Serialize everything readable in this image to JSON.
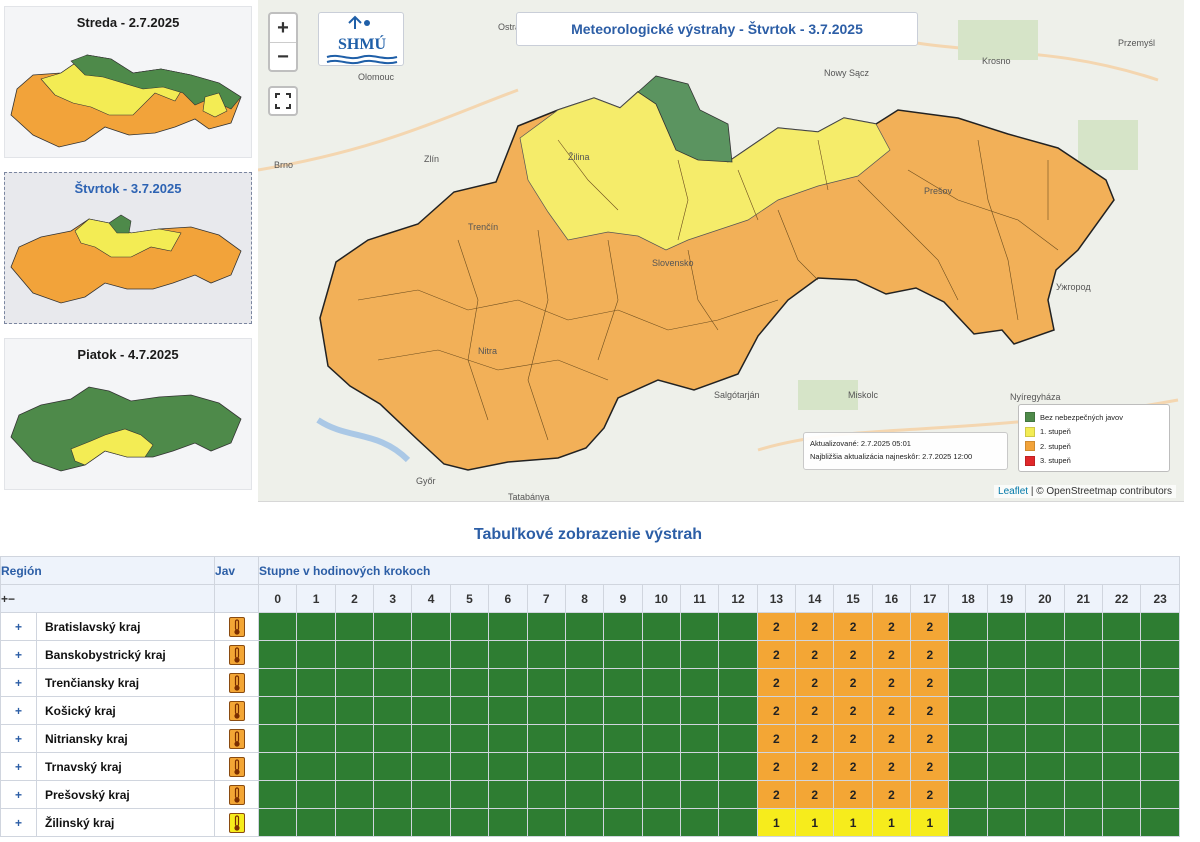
{
  "thumbnails": [
    {
      "title": "Streda - 2.7.2025"
    },
    {
      "title": "Štvrtok - 3.7.2025"
    },
    {
      "title": "Piatok - 4.7.2025"
    }
  ],
  "map": {
    "title": "Meteorologické výstrahy - Štvrtok - 3.7.2025",
    "logo_text": "SHMÚ",
    "zoom_in": "+",
    "zoom_out": "−",
    "updated": "Aktualizované: 2.7.2025 05:01",
    "next_update": "Najbližšia aktualizácia najneskôr: 2.7.2025 12:00",
    "legend": [
      {
        "label": "Bez nebezpečných javov",
        "color": "#4e8a4a"
      },
      {
        "label": "1. stupeň",
        "color": "#f3ec54"
      },
      {
        "label": "2. stupeň",
        "color": "#f2a33a"
      },
      {
        "label": "3. stupeň",
        "color": "#e0282a"
      }
    ],
    "attribution_leaflet": "Leaflet",
    "attribution_rest": "| © OpenStreetmap contributors",
    "places": [
      "Ostrava",
      "Olomouc",
      "Brno",
      "Zlín",
      "Krosno",
      "Nowy Sącz",
      "Przemyśl",
      "Salgótarján",
      "Miskolc",
      "Nyíregyháza",
      "Győr",
      "Tatabánya",
      "Prešov",
      "Nitra",
      "Trenčín",
      "Žilina",
      "Slovensko",
      "Ужгород"
    ]
  },
  "table": {
    "title": "Tabuľkové zobrazenie výstrah",
    "col_region": "Región",
    "col_jav": "Jav",
    "col_steps": "Stupne v hodinových krokoch",
    "expand_all": "+−",
    "hours": [
      "0",
      "1",
      "2",
      "3",
      "4",
      "5",
      "6",
      "7",
      "8",
      "9",
      "10",
      "11",
      "12",
      "13",
      "14",
      "15",
      "16",
      "17",
      "18",
      "19",
      "20",
      "21",
      "22",
      "23"
    ],
    "colors": {
      "0": "#2e7d32",
      "1": "#f6ec1c",
      "2": "#f3a635"
    },
    "rows": [
      {
        "name": "Bratislavský kraj",
        "level": 2,
        "levels": [
          0,
          0,
          0,
          0,
          0,
          0,
          0,
          0,
          0,
          0,
          0,
          0,
          0,
          2,
          2,
          2,
          2,
          2,
          0,
          0,
          0,
          0,
          0,
          0
        ]
      },
      {
        "name": "Banskobystrický kraj",
        "level": 2,
        "levels": [
          0,
          0,
          0,
          0,
          0,
          0,
          0,
          0,
          0,
          0,
          0,
          0,
          0,
          2,
          2,
          2,
          2,
          2,
          0,
          0,
          0,
          0,
          0,
          0
        ]
      },
      {
        "name": "Trenčiansky kraj",
        "level": 2,
        "levels": [
          0,
          0,
          0,
          0,
          0,
          0,
          0,
          0,
          0,
          0,
          0,
          0,
          0,
          2,
          2,
          2,
          2,
          2,
          0,
          0,
          0,
          0,
          0,
          0
        ]
      },
      {
        "name": "Košický kraj",
        "level": 2,
        "levels": [
          0,
          0,
          0,
          0,
          0,
          0,
          0,
          0,
          0,
          0,
          0,
          0,
          0,
          2,
          2,
          2,
          2,
          2,
          0,
          0,
          0,
          0,
          0,
          0
        ]
      },
      {
        "name": "Nitriansky kraj",
        "level": 2,
        "levels": [
          0,
          0,
          0,
          0,
          0,
          0,
          0,
          0,
          0,
          0,
          0,
          0,
          0,
          2,
          2,
          2,
          2,
          2,
          0,
          0,
          0,
          0,
          0,
          0
        ]
      },
      {
        "name": "Trnavský kraj",
        "level": 2,
        "levels": [
          0,
          0,
          0,
          0,
          0,
          0,
          0,
          0,
          0,
          0,
          0,
          0,
          0,
          2,
          2,
          2,
          2,
          2,
          0,
          0,
          0,
          0,
          0,
          0
        ]
      },
      {
        "name": "Prešovský kraj",
        "level": 2,
        "levels": [
          0,
          0,
          0,
          0,
          0,
          0,
          0,
          0,
          0,
          0,
          0,
          0,
          0,
          2,
          2,
          2,
          2,
          2,
          0,
          0,
          0,
          0,
          0,
          0
        ]
      },
      {
        "name": "Žilinský kraj",
        "level": 1,
        "levels": [
          0,
          0,
          0,
          0,
          0,
          0,
          0,
          0,
          0,
          0,
          0,
          0,
          0,
          1,
          1,
          1,
          1,
          1,
          0,
          0,
          0,
          0,
          0,
          0
        ]
      }
    ]
  }
}
